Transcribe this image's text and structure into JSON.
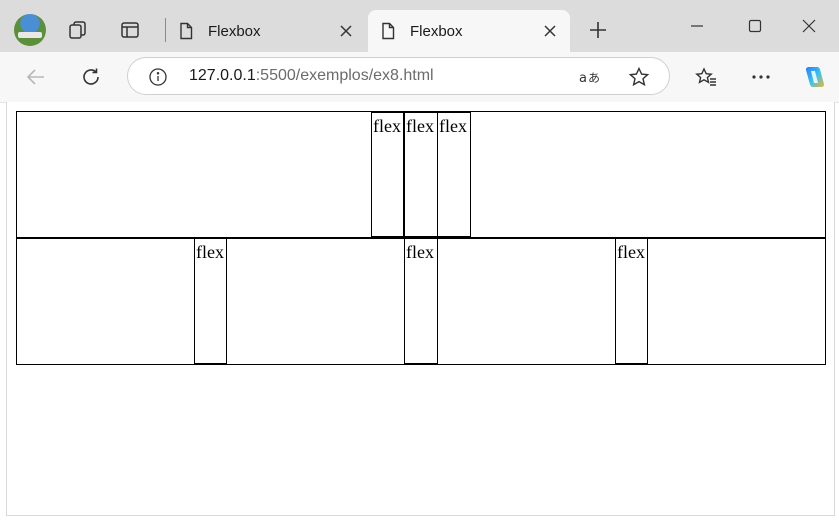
{
  "browser": {
    "tabs": [
      {
        "title": "Flexbox",
        "active": false
      },
      {
        "title": "Flexbox",
        "active": true
      }
    ],
    "address": {
      "host": "127.0.0.1",
      "rest": ":5500/exemplos/ex8.html"
    }
  },
  "page": {
    "row1": {
      "items": [
        "flex",
        "flex",
        "flex"
      ]
    },
    "row2": {
      "items": [
        "flex",
        "flex",
        "flex"
      ]
    }
  }
}
